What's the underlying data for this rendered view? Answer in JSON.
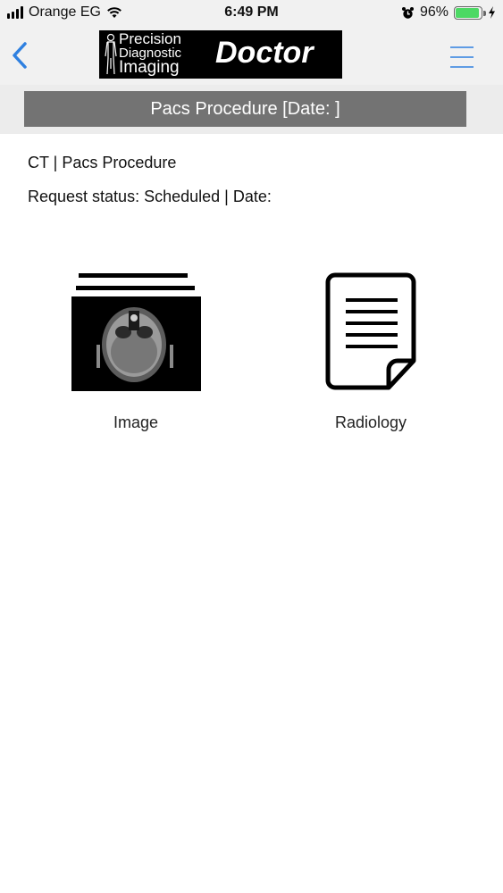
{
  "status_bar": {
    "carrier": "Orange EG",
    "time": "6:49 PM",
    "battery_percent": "96%",
    "battery_level": 0.96
  },
  "nav": {
    "logo_brand_line1": "Precision",
    "logo_brand_line2": "Diagnostic",
    "logo_brand_line3": "Imaging",
    "logo_doctor": "Doctor",
    "accent_color": "#2f80e0"
  },
  "header": {
    "title": "Pacs Procedure [Date: ]"
  },
  "procedure": {
    "line1": "CT | Pacs Procedure",
    "line2": "Request status: Scheduled | Date:"
  },
  "tiles": [
    {
      "label": "Image",
      "icon": "ct-scan-image-icon"
    },
    {
      "label": "Radiology",
      "icon": "document-icon"
    }
  ]
}
